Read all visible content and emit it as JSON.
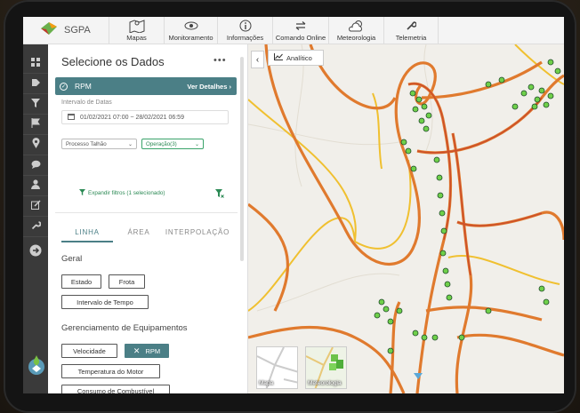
{
  "app": {
    "brand": "SGPA"
  },
  "topnav": [
    {
      "label": "Mapas",
      "icon": "map-icon"
    },
    {
      "label": "Monitoramento",
      "icon": "eye-icon"
    },
    {
      "label": "Informações",
      "icon": "info-icon"
    },
    {
      "label": "Comando Online",
      "icon": "swap-icon"
    },
    {
      "label": "Meteorologia",
      "icon": "weather-icon"
    },
    {
      "label": "Telemetria",
      "icon": "wrench-icon"
    }
  ],
  "rail": [
    "grid-icon",
    "tag-icon",
    "filter-icon",
    "flag-icon",
    "location-icon",
    "chat-icon",
    "user-icon",
    "edit-icon",
    "wrench-icon",
    "arrow-right-icon"
  ],
  "panel": {
    "title": "Selecione os Dados",
    "more": "•••",
    "selected_metric": "RPM",
    "detail_link": "Ver Detalhes",
    "interval_label": "Intervalo de Datas",
    "date_range": "01/02/2021 07:00  ~  28/02/2021 06:59",
    "select_processo": "Processo Talhão",
    "select_operacao": "Operação(3)",
    "expand_filters": "Expandir filtros (1 selecionado)",
    "tabs": [
      "LINHA",
      "ÁREA",
      "INTERPOLAÇÃO"
    ],
    "section_geral": "Geral",
    "geral_chips": [
      "Estado",
      "Frota",
      "Intervalo de Tempo"
    ],
    "section_equip": "Gerenciamento de Equipamentos",
    "equip_chips": [
      "Velocidade",
      "RPM",
      "Temperatura do Motor",
      "Consumo de Combustível"
    ]
  },
  "map": {
    "analitico_label": "Analítico",
    "thumbs": [
      "Mapa",
      "Meteorologia"
    ]
  },
  "colors": {
    "accent": "#4b7f86",
    "green": "#3aa36a",
    "road_orange": "#e07a2e",
    "road_yellow": "#f0c020",
    "road_red": "#c8452a"
  }
}
